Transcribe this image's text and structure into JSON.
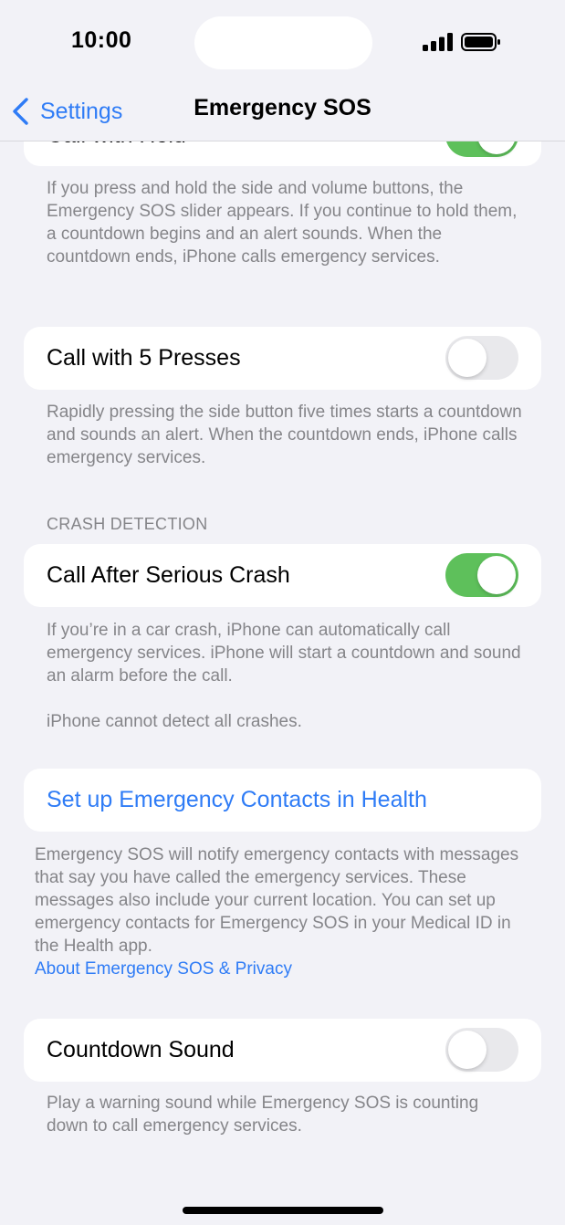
{
  "status": {
    "time": "10:00"
  },
  "nav": {
    "back_label": "Settings",
    "title": "Emergency SOS"
  },
  "call_with_hold": {
    "label": "Call with Hold",
    "enabled": true,
    "footnote": "If you press and hold the side and volume buttons, the Emergency SOS slider appears. If you continue to hold them, a countdown begins and an alert sounds. When the countdown ends, iPhone calls emergency services."
  },
  "call_with_5_presses": {
    "label": "Call with 5 Presses",
    "enabled": false,
    "footnote": "Rapidly pressing the side button five times starts a countdown and sounds an alert. When the countdown ends, iPhone calls emergency services."
  },
  "crash_detection": {
    "header": "CRASH DETECTION",
    "label": "Call After Serious Crash",
    "enabled": true,
    "footnote": "If you’re in a car crash, iPhone can automatically call emergency services. iPhone will start a countdown and sound an alarm before the call.",
    "footnote2": "iPhone cannot detect all crashes."
  },
  "emergency_contacts": {
    "link_label": "Set up Emergency Contacts in Health",
    "footnote": "Emergency SOS will notify emergency contacts with messages that say you have called the emergency services. These messages also include your current location. You can set up emergency contacts for Emergency SOS in your Medical ID in the Health app.",
    "privacy_link": "About Emergency SOS & Privacy"
  },
  "countdown_sound": {
    "label": "Countdown Sound",
    "enabled": false,
    "footnote": "Play a warning sound while Emergency SOS is counting down to call emergency services."
  },
  "colors": {
    "accent": "#2f7cf6",
    "toggle_on": "#5ec05b",
    "background": "#f2f2f7"
  }
}
